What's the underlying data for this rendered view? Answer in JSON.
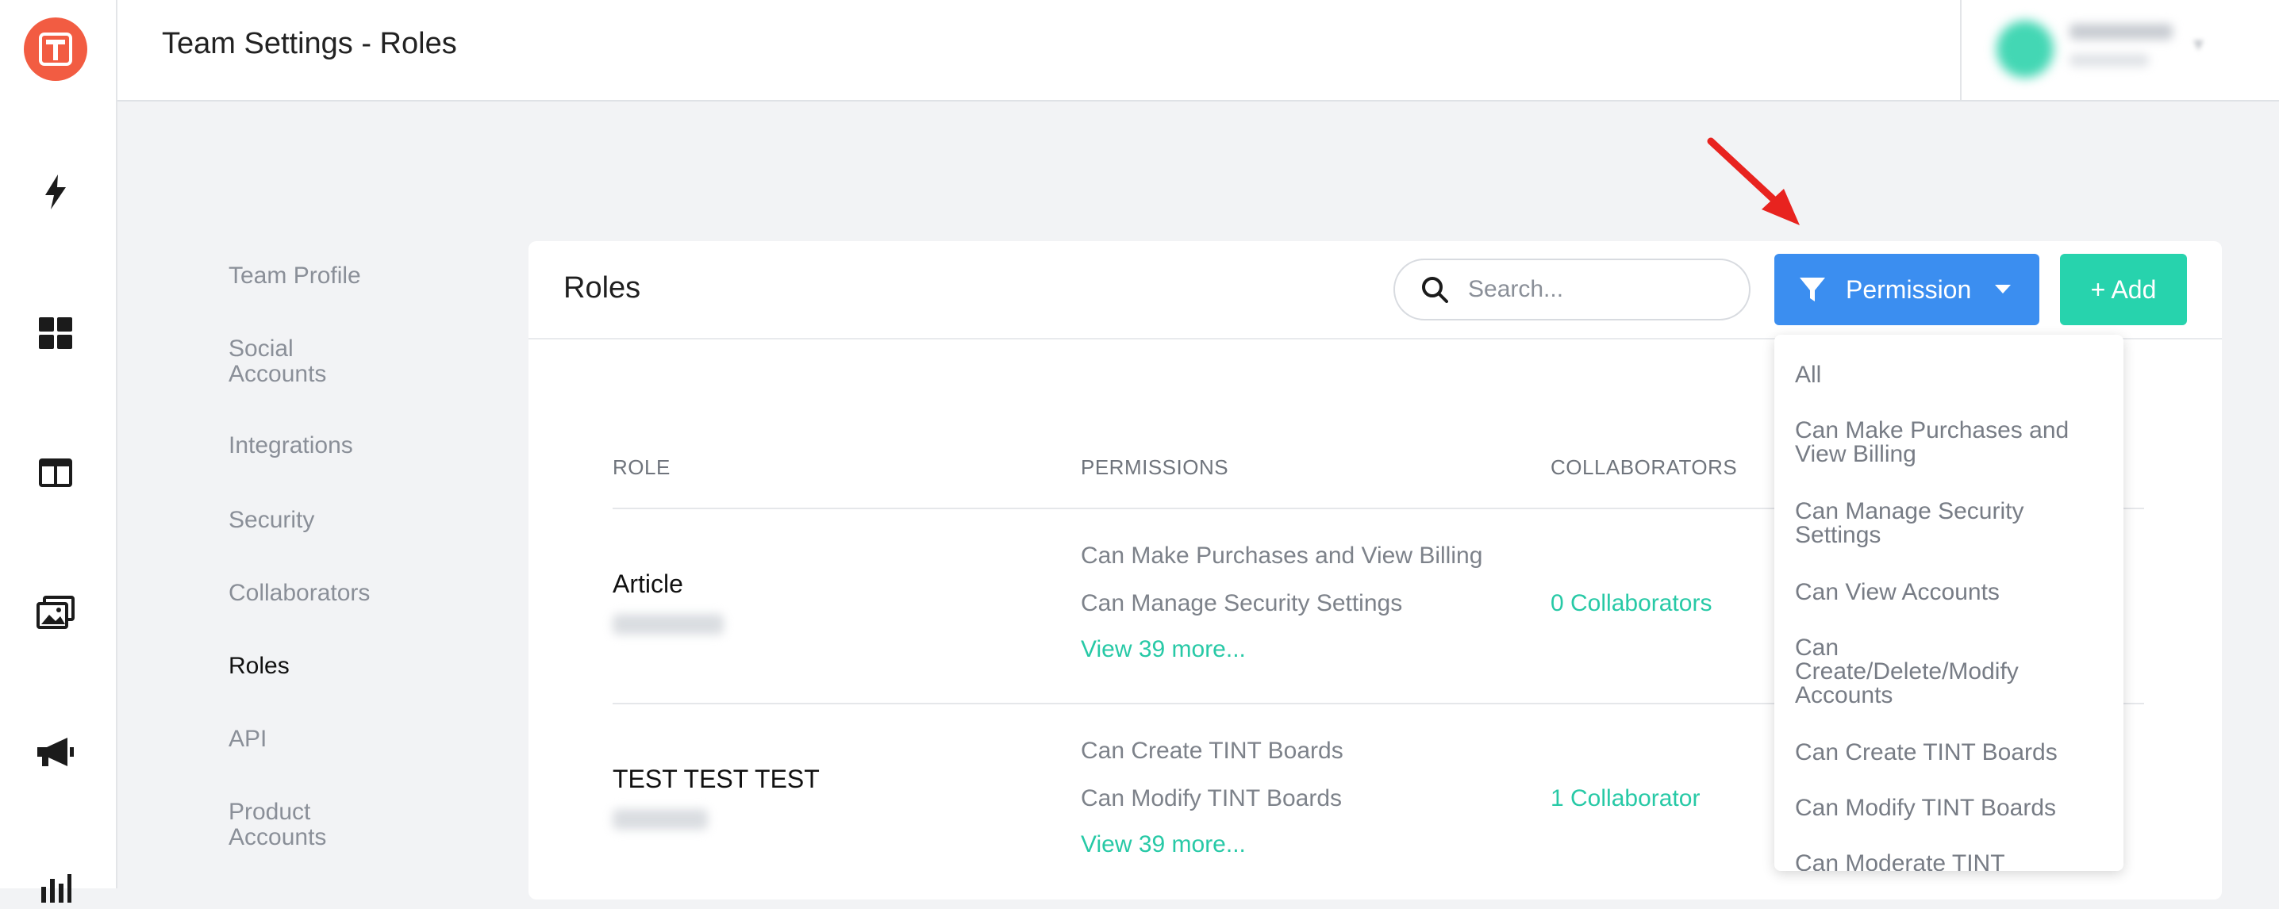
{
  "header": {
    "title": "Team Settings - Roles"
  },
  "rail": {
    "logo_letter": "T",
    "icons": [
      "lightning-icon",
      "dashboard-icon",
      "layout-icon",
      "media-icon",
      "megaphone-icon",
      "analytics-icon"
    ]
  },
  "settings_nav": {
    "items": [
      {
        "label": "Team Profile",
        "active": false
      },
      {
        "label": "Social Accounts",
        "active": false
      },
      {
        "label": "Integrations",
        "active": false
      },
      {
        "label": "Security",
        "active": false
      },
      {
        "label": "Collaborators",
        "active": false
      },
      {
        "label": "Roles",
        "active": true
      },
      {
        "label": "API",
        "active": false
      },
      {
        "label": "Product Accounts",
        "active": false
      }
    ]
  },
  "card": {
    "title": "Roles",
    "search_placeholder": "Search...",
    "filter_label": "Permission",
    "add_label": "+ Add"
  },
  "table": {
    "columns": [
      "ROLE",
      "PERMISSIONS",
      "COLLABORATORS"
    ],
    "rows": [
      {
        "role": "Article",
        "permissions": [
          "Can Make Purchases and View Billing",
          "Can Manage Security Settings"
        ],
        "more": "View 39 more...",
        "collaborators": "0 Collaborators"
      },
      {
        "role": "TEST TEST TEST",
        "permissions": [
          "Can Create TINT Boards",
          "Can Modify TINT Boards"
        ],
        "more": "View 39 more...",
        "collaborators": "1 Collaborator"
      }
    ]
  },
  "dropdown": {
    "items": [
      "All",
      "Can Make Purchases and View Billing",
      "Can Manage Security Settings",
      "Can View Accounts",
      "Can Create/Delete/Modify Accounts",
      "Can Create TINT Boards",
      "Can Modify TINT Boards",
      "Can Moderate TINT"
    ]
  },
  "colors": {
    "logo": "#f25c42",
    "primary_button": "#3b8ef0",
    "add_button": "#27d3ad",
    "link": "#27c9a6",
    "annotation_arrow": "#e8231f"
  }
}
